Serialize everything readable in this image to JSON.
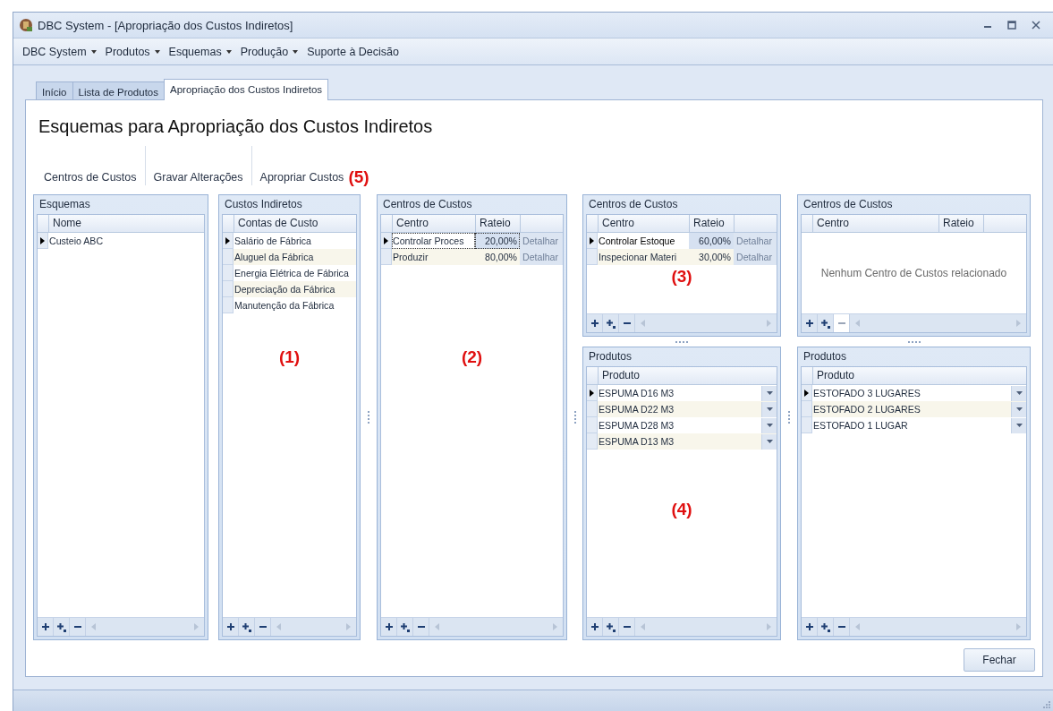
{
  "window": {
    "title": "DBC System - [Apropriação dos Custos Indiretos]"
  },
  "menu": [
    {
      "label": "DBC System",
      "dropdown": true
    },
    {
      "label": "Produtos",
      "dropdown": true
    },
    {
      "label": "Esquemas",
      "dropdown": true
    },
    {
      "label": "Produção",
      "dropdown": true
    },
    {
      "label": "Suporte à Decisão",
      "dropdown": false
    }
  ],
  "tabs": [
    {
      "label": "Início",
      "selected": false
    },
    {
      "label": "Lista de Produtos",
      "selected": false
    },
    {
      "label": "Apropriação dos Custos Indiretos",
      "selected": true
    }
  ],
  "heading": "Esquemas para Apropriação dos Custos Indiretos",
  "toolbar": {
    "buttons": [
      "Centros de Custos",
      "Gravar Alterações",
      "Apropriar Custos"
    ],
    "annotation": "(5)"
  },
  "panel_columns": [
    {
      "panels": [
        {
          "title": "Esquemas",
          "columns": [
            {
              "label": "Nome",
              "kind": "text"
            }
          ],
          "rows": [
            {
              "cells": [
                "Custeio ABC"
              ],
              "selected": true
            }
          ],
          "remove_disabled": false
        }
      ]
    },
    {
      "panels": [
        {
          "title": "Custos Indiretos",
          "columns": [
            {
              "label": "Contas de Custo",
              "kind": "text"
            }
          ],
          "rows": [
            {
              "cells": [
                "Salário de Fábrica"
              ],
              "selected": true
            },
            {
              "cells": [
                "Aluguel da Fábrica"
              ],
              "selected": false
            },
            {
              "cells": [
                "Energia Elétrica de Fábrica"
              ],
              "selected": false
            },
            {
              "cells": [
                "Depreciação da Fábrica"
              ],
              "selected": false
            },
            {
              "cells": [
                "Manutenção da Fábrica"
              ],
              "selected": false
            }
          ],
          "remove_disabled": false,
          "annotation": "(1)"
        }
      ]
    },
    {
      "panels": [
        {
          "title": "Centros de Custos",
          "columns": [
            {
              "label": "Centro",
              "kind": "text"
            },
            {
              "label": "Rateio",
              "kind": "percent"
            },
            {
              "kind": "action"
            }
          ],
          "rows": [
            {
              "cells": [
                "Controlar Proces",
                "20,00%",
                "Detalhar"
              ],
              "selected": true
            },
            {
              "cells": [
                "Produzir",
                "80,00%",
                "Detalhar"
              ],
              "selected": false
            }
          ],
          "remove_disabled": false,
          "annotation": "(2)"
        }
      ]
    },
    {
      "panels": [
        {
          "title": "Centros de Custos",
          "columns": [
            {
              "label": "Centro",
              "kind": "text"
            },
            {
              "label": "Rateio",
              "kind": "percent"
            },
            {
              "kind": "action"
            }
          ],
          "rows": [
            {
              "cells": [
                "Controlar Estoque",
                "60,00%",
                "Detalhar"
              ],
              "selected": true
            },
            {
              "cells": [
                "Inspecionar Materi",
                "30,00%",
                "Detalhar"
              ],
              "selected": false
            }
          ],
          "remove_disabled": false,
          "annotation": "(3)"
        },
        {
          "title": "Produtos",
          "columns": [
            {
              "label": "Produto",
              "kind": "combo"
            }
          ],
          "rows": [
            {
              "cells": [
                "ESPUMA D16 M3"
              ],
              "selected": true
            },
            {
              "cells": [
                "ESPUMA D22 M3"
              ],
              "selected": false
            },
            {
              "cells": [
                "ESPUMA D28 M3"
              ],
              "selected": false
            },
            {
              "cells": [
                "ESPUMA D13 M3"
              ],
              "selected": false
            }
          ],
          "remove_disabled": false,
          "annotation": "(4)"
        }
      ]
    },
    {
      "panels": [
        {
          "title": "Centros de Custos",
          "columns": [
            {
              "label": "Centro",
              "kind": "text"
            },
            {
              "label": "Rateio",
              "kind": "percent"
            },
            {
              "kind": "action"
            }
          ],
          "empty_text": "Nenhum Centro de Custos relacionado",
          "remove_disabled": true
        },
        {
          "title": "Produtos",
          "columns": [
            {
              "label": "Produto",
              "kind": "combo"
            }
          ],
          "rows": [
            {
              "cells": [
                "ESTOFADO 3 LUGARES"
              ],
              "selected": true
            },
            {
              "cells": [
                "ESTOFADO 2 LUGARES"
              ],
              "selected": false
            },
            {
              "cells": [
                "ESTOFADO 1 LUGAR"
              ],
              "selected": false
            }
          ],
          "remove_disabled": false
        }
      ]
    }
  ],
  "close_button": "Fechar"
}
